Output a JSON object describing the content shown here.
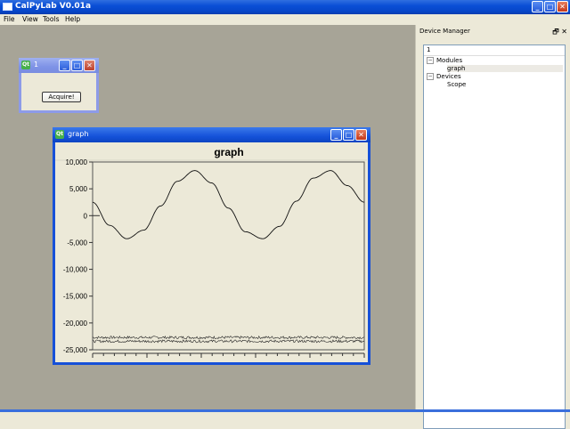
{
  "app": {
    "title": "CalPyLab V0.01a"
  },
  "menu": [
    "File",
    "View",
    "Tools",
    "Help"
  ],
  "acquire_window": {
    "title": "1",
    "button_label": "Acquire!"
  },
  "graph_window": {
    "title": "graph",
    "plot_title": "graph"
  },
  "device_manager": {
    "title": "Device Manager",
    "header": "1",
    "tree": [
      {
        "label": "Modules",
        "expanded": true,
        "children": [
          "graph"
        ]
      },
      {
        "label": "Devices",
        "expanded": true,
        "children": [
          "Scope"
        ]
      }
    ]
  },
  "chart_data": {
    "type": "line",
    "title": "graph",
    "xlabel": "",
    "ylabel": "",
    "xlim": [
      0,
      500
    ],
    "ylim": [
      -25000,
      10000
    ],
    "xticks": [
      0,
      100,
      200,
      300,
      400,
      500
    ],
    "yticks": [
      10000,
      5000,
      0,
      -5000,
      -10000,
      -15000,
      -20000,
      -25000
    ],
    "ytick_labels": [
      "10,000",
      "5,000",
      "0",
      "-5,000",
      "-10,000",
      "-15,000",
      "-20,000",
      "-25,000"
    ],
    "series": [
      {
        "style": "sine",
        "x": [
          0,
          31,
          63,
          94,
          125,
          156,
          188,
          219,
          250,
          281,
          313,
          344,
          375,
          406,
          438,
          469,
          500
        ],
        "values": [
          2500,
          -1800,
          -4300,
          -2700,
          1800,
          6400,
          8400,
          6100,
          1400,
          -3000,
          -4300,
          -2000,
          2700,
          7000,
          8400,
          5600,
          2500
        ]
      },
      {
        "style": "noise",
        "mean": -22700,
        "amplitude": 250
      },
      {
        "style": "noise",
        "mean": -23400,
        "amplitude": 250
      }
    ],
    "grid": false
  }
}
